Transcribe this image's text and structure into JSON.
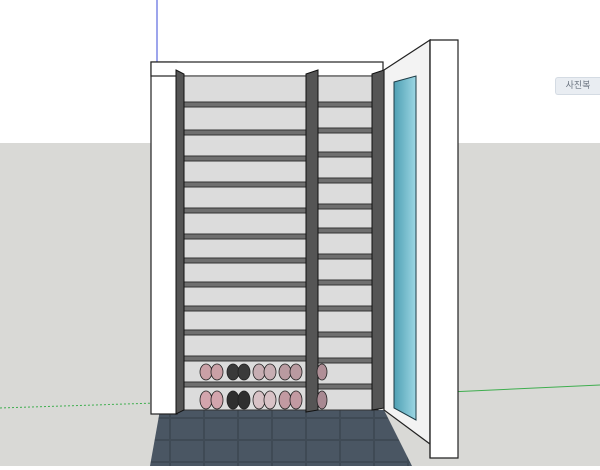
{
  "app": {
    "view_tag": "사진복"
  },
  "scene": {
    "sky_color": "#ffffff",
    "ground_color": "#d9d9d6",
    "cabinet": {
      "shelves_per_column": 16,
      "columns": 2,
      "shoe_rows": 2,
      "shoe_pairs_per_row": 6
    }
  }
}
